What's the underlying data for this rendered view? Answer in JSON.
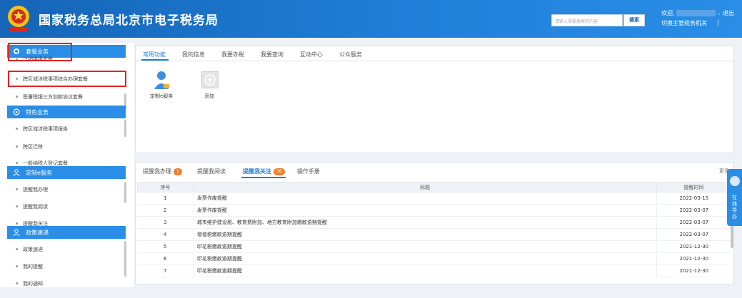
{
  "header": {
    "title": "国家税务总局北京市电子税务局",
    "search_placeholder": "请输入需要搜索的内容",
    "search_button": "搜索",
    "welcome": "欢迎,",
    "comma": ",",
    "logout": "退出",
    "switch_authority": "切换主管税务机关",
    "separator": "|"
  },
  "sidebar": {
    "sections": [
      {
        "title": "套餐业务",
        "icon": "package-icon"
      },
      {
        "title": "特色业务",
        "icon": "feature-icon"
      },
      {
        "title": "定制e服务",
        "icon": "person-icon"
      },
      {
        "title": "政策速递",
        "icon": "person-icon"
      }
    ],
    "items": [
      "注销申报套餐",
      "跨区域涉税事项综合办理套餐",
      "签署税银三方划款协议套餐",
      "跨区域涉税事项报告",
      "跨区迁移",
      "一般纳税人登记套餐",
      "提醒我办理",
      "提醒我阅读",
      "提醒我关注",
      "政策速递",
      "我的提醒",
      "我的通知"
    ]
  },
  "functions": {
    "tabs": [
      "常用功能",
      "我的信息",
      "我要办税",
      "我要查询",
      "互动中心",
      "公众服务"
    ],
    "active_tab": 0,
    "items": [
      {
        "label": "定制e服务",
        "icon": "user-service-icon"
      },
      {
        "label": "添加",
        "icon": "add-icon"
      }
    ]
  },
  "list": {
    "tabs": [
      {
        "label": "提醒我办理",
        "badge": "1"
      },
      {
        "label": "提醒我阅读",
        "badge": ""
      },
      {
        "label": "提醒我关注",
        "badge": "36"
      },
      {
        "label": "操作手册",
        "badge": ""
      }
    ],
    "active_tab": 2,
    "more": "更多",
    "columns": [
      "序号",
      "标题",
      "提醒时间"
    ],
    "rows": [
      {
        "no": "1",
        "title": "发票作废提醒",
        "date": "2022-03-15"
      },
      {
        "no": "2",
        "title": "发票作废提醒",
        "date": "2022-03-07"
      },
      {
        "no": "3",
        "title": "城市维护建设税、教育费附加、地方教育附加缴款逾期提醒",
        "date": "2022-03-07"
      },
      {
        "no": "4",
        "title": "增值税缴款逾期提醒",
        "date": "2022-03-07"
      },
      {
        "no": "5",
        "title": "印花税缴款逾期提醒",
        "date": "2021-12-30"
      },
      {
        "no": "6",
        "title": "印花税缴款逾期提醒",
        "date": "2021-12-30"
      },
      {
        "no": "7",
        "title": "印花税缴款逾期提醒",
        "date": "2021-12-30"
      }
    ]
  },
  "float_nav": {
    "label": "在线导办"
  },
  "colors": {
    "primary": "#1f7fd8",
    "header": "#1565b8",
    "badge": "#f07d2b",
    "annotation": "#e02424"
  }
}
